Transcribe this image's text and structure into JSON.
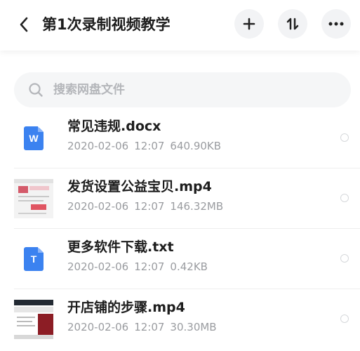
{
  "header": {
    "title": "第1次录制视频教学",
    "back_icon": "chevron-left-icon",
    "add_icon": "plus-icon",
    "sort_icon": "sort-icon",
    "more_icon": "more-dots-icon"
  },
  "search": {
    "placeholder": "搜索网盘文件",
    "value": ""
  },
  "colors": {
    "accent": "#3b82f0",
    "button_bg": "#f2f3f5",
    "search_bg": "#f5f6f7",
    "meta_text": "#9a9ca0"
  },
  "files": [
    {
      "name": "常见违规.docx",
      "date": "2020-02-06",
      "time": "12:07",
      "size": "640.90KB",
      "icon": "word-doc-icon",
      "icon_letter": "W"
    },
    {
      "name": "发货设置公益宝贝.mp4",
      "date": "2020-02-06",
      "time": "12:07",
      "size": "146.32MB",
      "icon": "video-thumbnail"
    },
    {
      "name": "更多软件下载.txt",
      "date": "2020-02-06",
      "time": "12:07",
      "size": "0.42KB",
      "icon": "text-doc-icon",
      "icon_letter": "T"
    },
    {
      "name": "开店铺的步骤.mp4",
      "date": "2020-02-06",
      "time": "12:07",
      "size": "30.30MB",
      "icon": "video-thumbnail"
    }
  ]
}
